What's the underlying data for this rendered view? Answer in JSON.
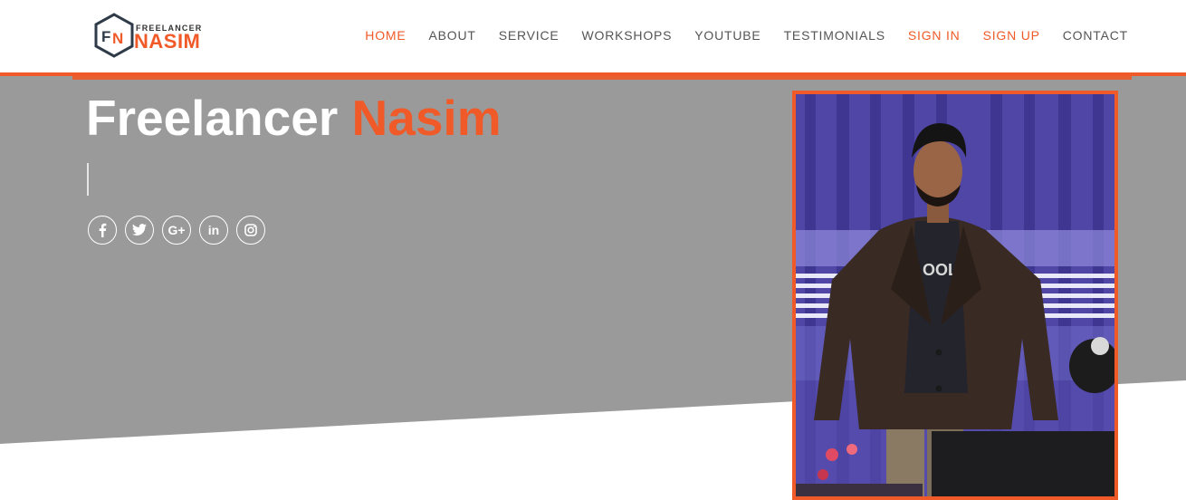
{
  "brand": {
    "logo_mark": "FN",
    "logo_top": "FREELANCER",
    "logo_bottom": "NASIM"
  },
  "nav": [
    {
      "label": "HOME",
      "active": true
    },
    {
      "label": "ABOUT"
    },
    {
      "label": "SERVICE"
    },
    {
      "label": "WORKSHOPS"
    },
    {
      "label": "YOUTUBE"
    },
    {
      "label": "TESTIMONIALS"
    },
    {
      "label": "SIGN IN",
      "accent": true
    },
    {
      "label": "SIGN UP",
      "accent": true
    },
    {
      "label": "CONTACT"
    }
  ],
  "hero": {
    "title_first": "Freelancer",
    "title_second": "Nasim"
  },
  "social": [
    {
      "icon": "facebook-icon",
      "glyph": "f"
    },
    {
      "icon": "twitter-icon",
      "glyph": "t"
    },
    {
      "icon": "google-plus-icon",
      "glyph": "G+"
    },
    {
      "icon": "linkedin-icon",
      "glyph": "in"
    },
    {
      "icon": "instagram-icon",
      "glyph": "◎"
    }
  ],
  "colors": {
    "accent": "#f05a28",
    "hero_bg": "#9a9a9a",
    "nav_text": "#555555"
  }
}
